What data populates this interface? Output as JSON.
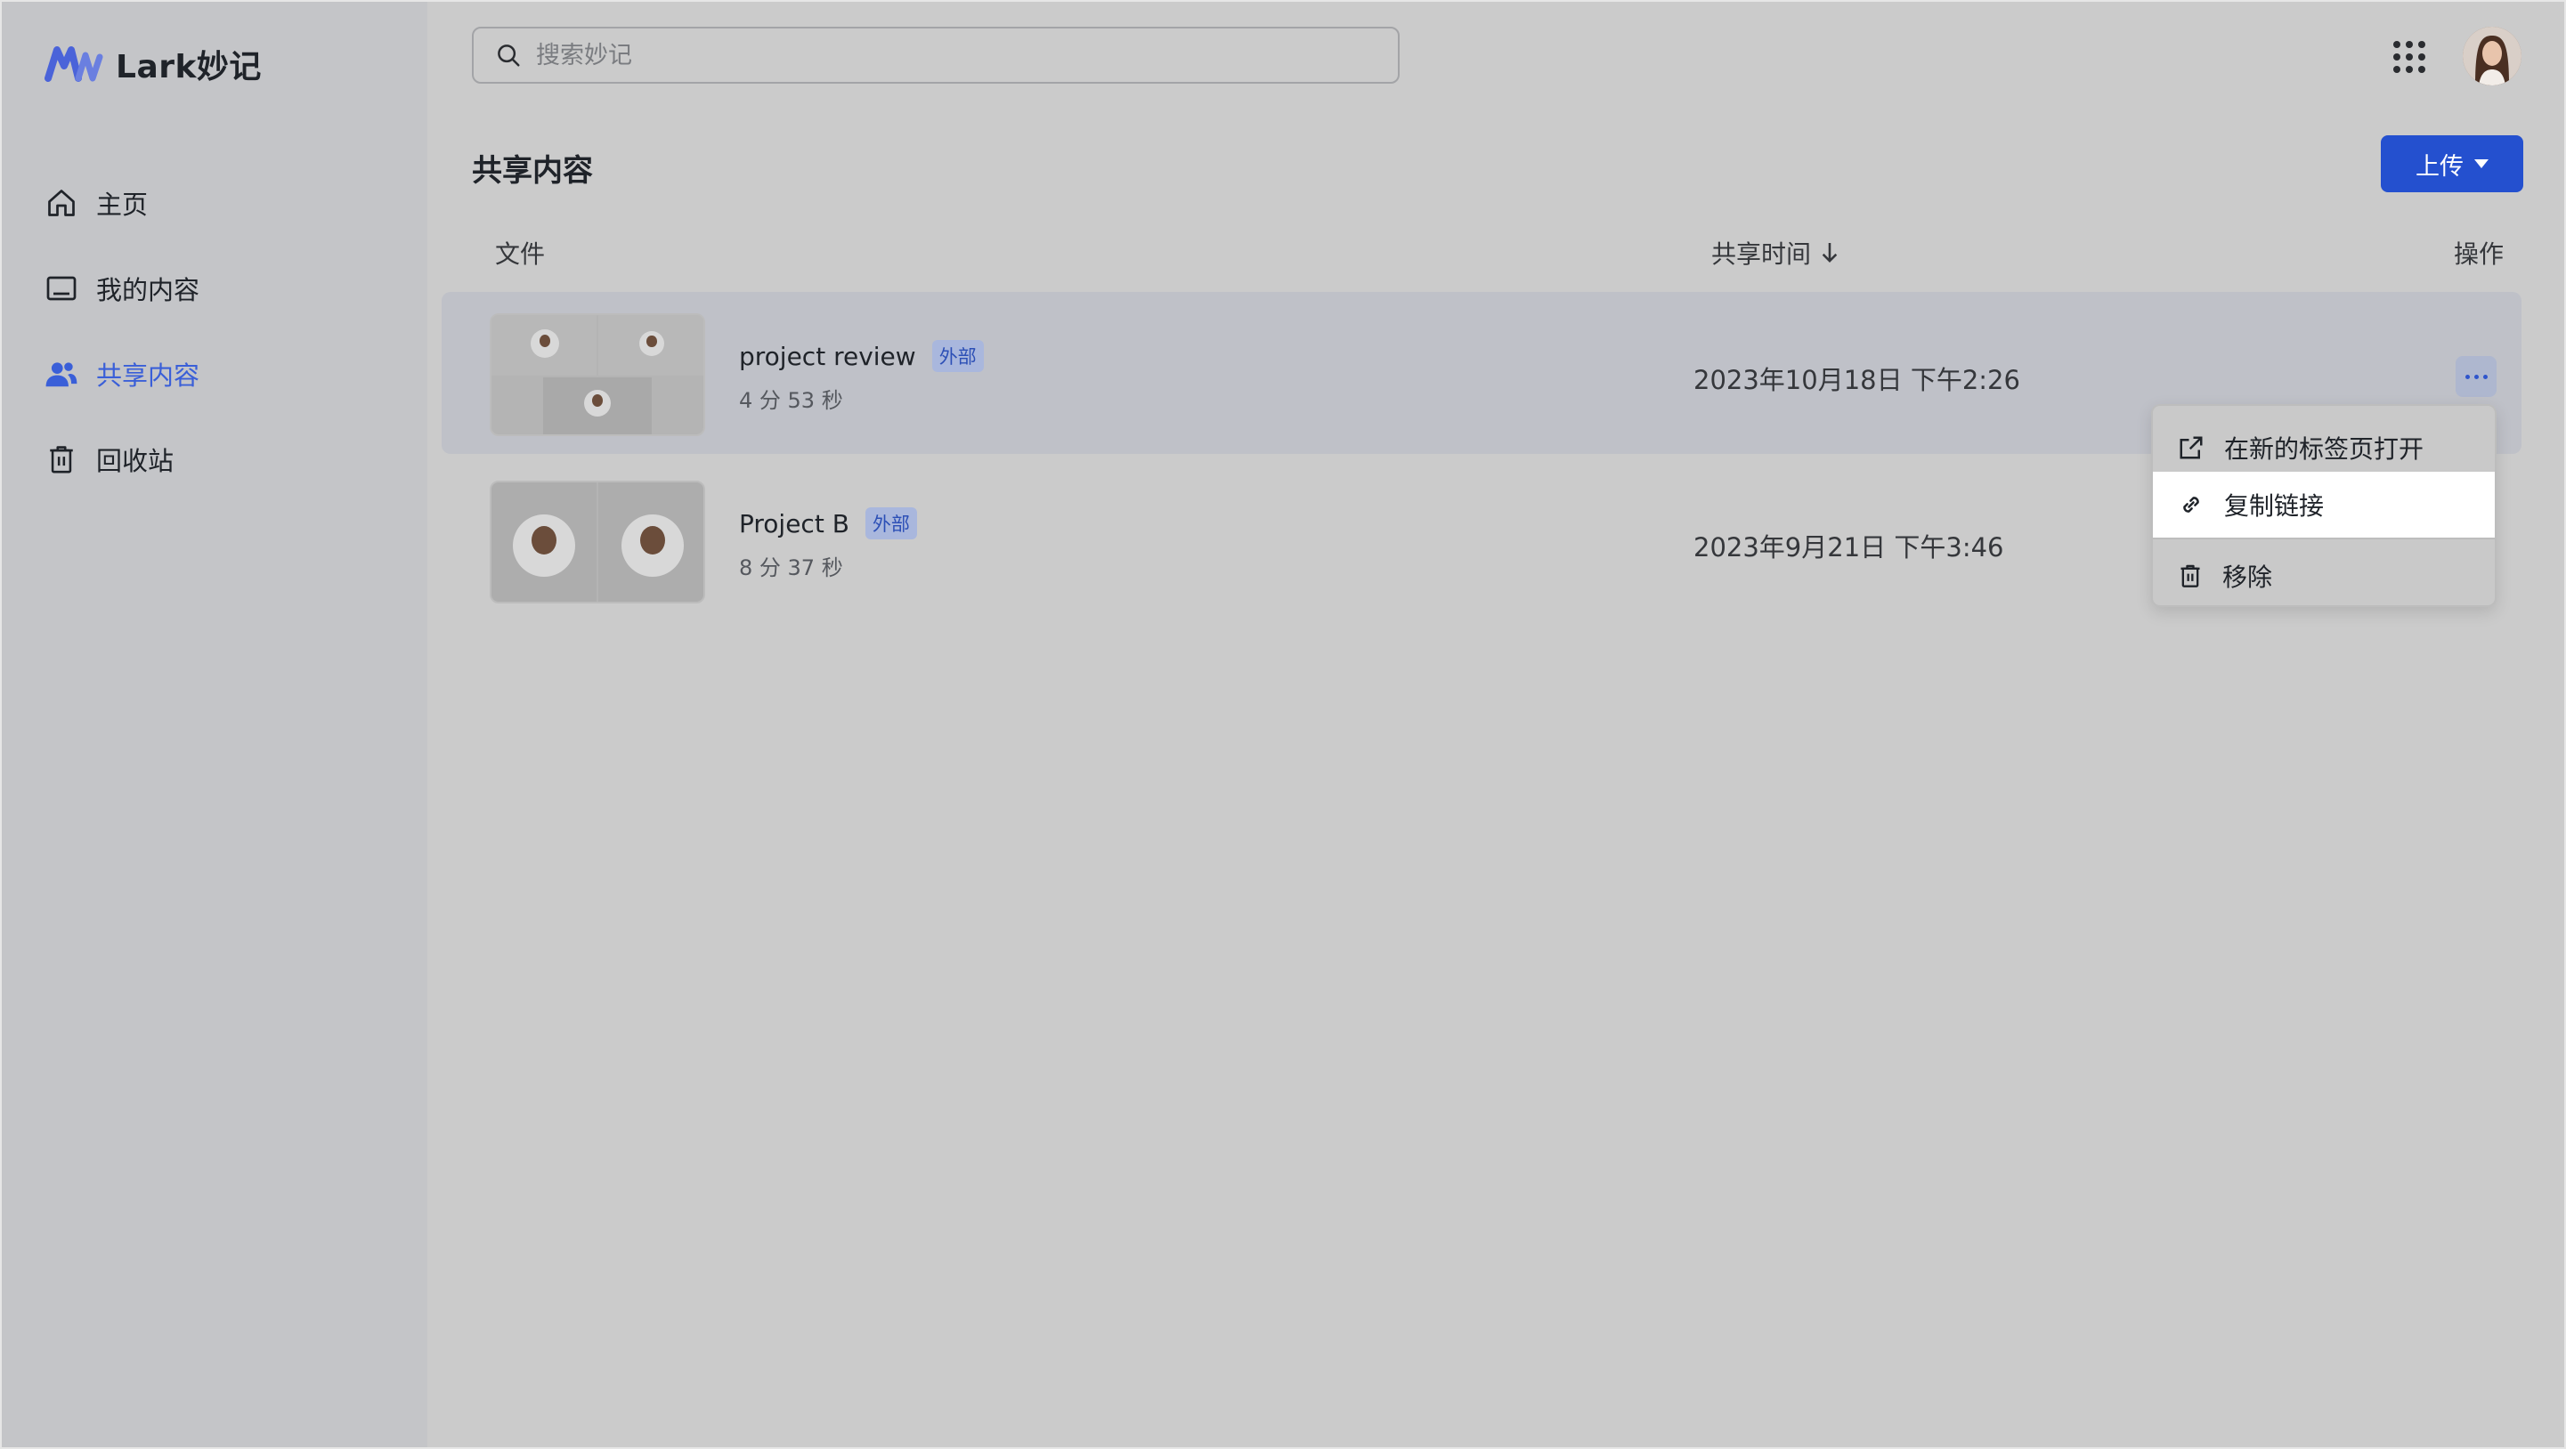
{
  "app": {
    "name": "Lark妙记"
  },
  "sidebar": {
    "items": [
      {
        "label": "主页",
        "icon": "home-icon",
        "active": false
      },
      {
        "label": "我的内容",
        "icon": "folder-icon",
        "active": false
      },
      {
        "label": "共享内容",
        "icon": "users-icon",
        "active": true
      },
      {
        "label": "回收站",
        "icon": "trash-icon",
        "active": false
      }
    ]
  },
  "search": {
    "placeholder": "搜索妙记",
    "value": ""
  },
  "page": {
    "title": "共享内容",
    "upload_label": "上传"
  },
  "table": {
    "columns": {
      "file": "文件",
      "share_time": "共享时间",
      "actions": "操作"
    },
    "rows": [
      {
        "name": "project review",
        "tag": "外部",
        "duration": "4 分 53 秒",
        "shared_at": "2023年10月18日 下午2:26"
      },
      {
        "name": "Project B",
        "tag": "外部",
        "duration": "8 分 37 秒",
        "shared_at": "2023年9月21日 下午3:46"
      }
    ]
  },
  "context_menu": {
    "items": [
      {
        "label": "在新的标签页打开",
        "icon": "external-link-icon"
      },
      {
        "label": "复制链接",
        "icon": "link-icon",
        "hovered": true
      },
      {
        "label": "移除",
        "icon": "trash-icon"
      }
    ]
  },
  "colors": {
    "accent": "#2450cf",
    "active_nav": "#3a5fd8",
    "tag_bg": "#a9b7dd"
  }
}
